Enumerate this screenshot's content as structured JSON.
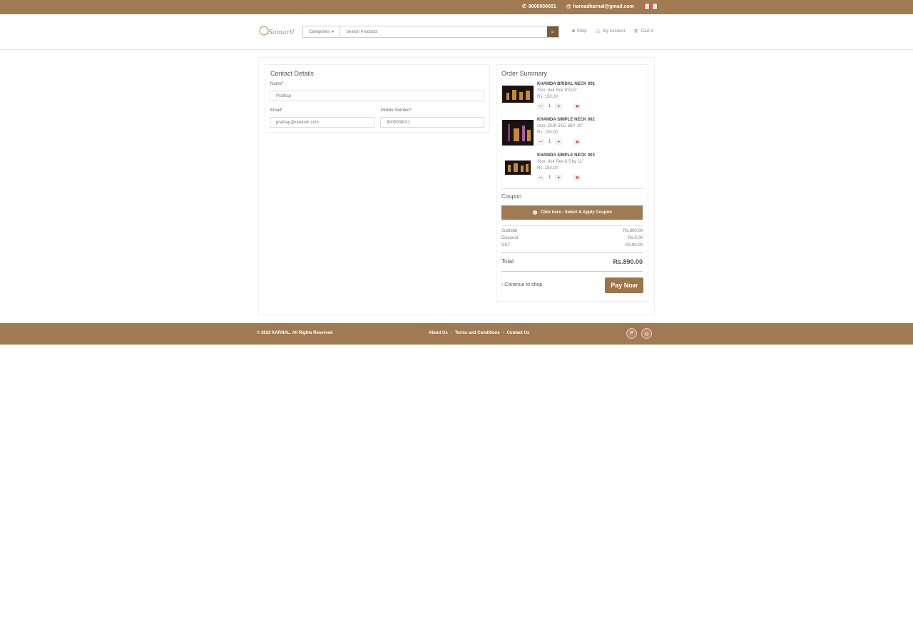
{
  "topbar": {
    "phone": "9000000001",
    "email": "haroadkarnal@gmail.com"
  },
  "header": {
    "logo_text": "Samarth",
    "category_label": "Categories",
    "search_placeholder": "Search Products",
    "nav": {
      "shop": "Shop",
      "account": "My Account",
      "cart": "Cart 3"
    }
  },
  "contact": {
    "title": "Contact Details",
    "name_label": "Name*",
    "name_value": "Prathap",
    "email_label": "Email*",
    "email_value": "prathap@random.com",
    "mobile_label": "Mobile Number*",
    "mobile_value": "9000000011"
  },
  "summary": {
    "title": "Order Summary",
    "products": [
      {
        "name": "KHAMDA BRIDAL NECK 001",
        "size": "Size: 4x4 Rex 8'X10\"",
        "price": "Rs. 150.00",
        "qty": "1"
      },
      {
        "name": "KHAMDA SIMPLE NECK 002",
        "size": "Size: DUP 5'LE 6BY 10\"",
        "price": "Rs. 150.00",
        "qty": "1"
      },
      {
        "name": "KHAMDA SIMPLE NECK 003",
        "size": "Size: 4x4 Rex 8.5 by 11\"",
        "price": "Rs. 150.00",
        "qty": "1"
      }
    ],
    "coupon_title": "Coupon",
    "coupon_button": "Click here - Select & Apply Coupon",
    "subtotal_label": "Subtotal",
    "subtotal_value": "Rs.800.00",
    "discount_label": "Discount",
    "discount_value": "Rs.0.00",
    "gst_label": "GST",
    "gst_value": "Rs.90.00",
    "total_label": "Total",
    "total_value": "Rs.890.00",
    "continue_label": "‹ Continue to shop",
    "pay_button": "Pay Now"
  },
  "footer": {
    "copyright": "© 2022 KARNAL. All Rights Reserved",
    "links": [
      "About Us",
      "Terms and Conditions",
      "Contact Us"
    ]
  },
  "colors": {
    "brand": "#a07a52",
    "dark_brand": "#7a5c3a",
    "delete": "#dd3333"
  }
}
